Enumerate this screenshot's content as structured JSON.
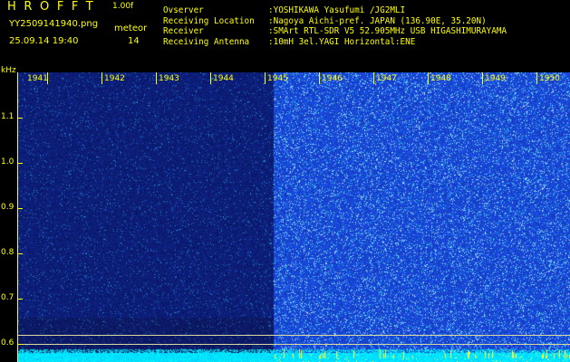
{
  "header": {
    "title": "HROFFT",
    "version": "1.00f",
    "filename": "YY2509141940.png",
    "meteor_label": "meteor",
    "datetime": "25.09.14 19:40",
    "meteor_count": "14"
  },
  "info": {
    "observer_key": "Ovserver",
    "observer_val": ":YOSHIKAWA Yasufumi /JG2MLI",
    "location_key": "Receiving Location",
    "location_val": ":Nagoya Aichi-pref. JAPAN (136.90E, 35.20N)",
    "receiver_key": "Receiver",
    "receiver_val": ":SMArt RTL-SDR V5 52.905MHz USB HIGASHIMURAYAMA",
    "antenna_key": "Receiving Antenna",
    "antenna_val": ":10mH 3el.YAGI Horizontal:ENE"
  },
  "axis": {
    "unit": "kHz",
    "y_labels": [
      "1.1",
      "1.0",
      "0.9",
      "0.8",
      "0.7",
      "0.6"
    ],
    "x_labels": [
      "1941",
      "1942",
      "1943",
      "1944",
      "1945",
      "1946",
      "1947",
      "1948",
      "1949",
      "1950"
    ]
  },
  "colors": {
    "text": "#ffff00",
    "baseline": "#d9d9a0",
    "noise_bottom": "#00e5ff",
    "background_dark": "#0a0d5a",
    "background_bright": "#1a35c8"
  }
}
